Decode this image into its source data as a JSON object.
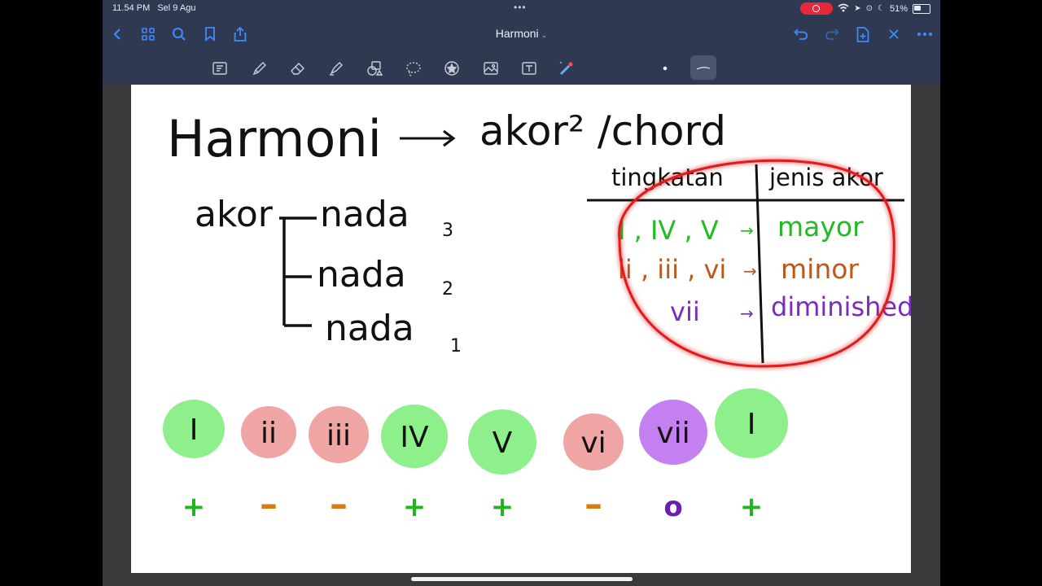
{
  "status_bar": {
    "time": "11.54 PM",
    "date": "Sel 9 Agu",
    "battery_text": "51%",
    "battery_level": 0.51,
    "dots": "•••"
  },
  "nav": {
    "title": "Harmoni",
    "title_chevron": "⌄"
  },
  "toolbar": {
    "tools": [
      "lasso-select-icon",
      "pen-icon",
      "eraser-icon",
      "highlighter-icon",
      "shapes-icon",
      "lasso-icon",
      "sticker-icon",
      "image-icon",
      "text-tool-icon",
      "laser-pointer-icon",
      "color-dot-icon",
      "stroke-width-icon"
    ]
  },
  "note": {
    "title_left": "Harmoni",
    "title_right": "akor² /chord",
    "akor_label": "akor",
    "nada_lines": [
      {
        "label": "nada",
        "num": "3"
      },
      {
        "label": "nada",
        "num": "2"
      },
      {
        "label": "nada",
        "num": "1"
      }
    ],
    "table": {
      "headers": [
        "tingkatan",
        "jenis akor"
      ],
      "rows": [
        {
          "degrees": "I , IV , V",
          "type": "mayor",
          "color": "#22bb22"
        },
        {
          "degrees": "ii , iii , vi",
          "type": "minor",
          "color": "#c0561a"
        },
        {
          "degrees": "vii",
          "type": "diminished",
          "color": "#7a2bc0"
        }
      ]
    },
    "chords": [
      {
        "label": "I",
        "fill": "#8df08a",
        "symbol": "+",
        "symbol_color": "#1fb51f"
      },
      {
        "label": "ii",
        "fill": "#f0a5a5",
        "symbol": "–",
        "symbol_color": "#d97b10"
      },
      {
        "label": "iii",
        "fill": "#f0a5a5",
        "symbol": "–",
        "symbol_color": "#d97b10"
      },
      {
        "label": "IV",
        "fill": "#8df08a",
        "symbol": "+",
        "symbol_color": "#1fb51f"
      },
      {
        "label": "V",
        "fill": "#8df08a",
        "symbol": "+",
        "symbol_color": "#1fb51f"
      },
      {
        "label": "vi",
        "fill": "#f0a5a5",
        "symbol": "–",
        "symbol_color": "#d97b10"
      },
      {
        "label": "vii",
        "fill": "#c47ff0",
        "symbol": "o",
        "symbol_color": "#6a1fb0"
      },
      {
        "label": "I",
        "fill": "#8df08a",
        "symbol": "+",
        "symbol_color": "#1fb51f"
      }
    ],
    "ink_color": "#111111",
    "circle_color": "#e01a1a"
  }
}
